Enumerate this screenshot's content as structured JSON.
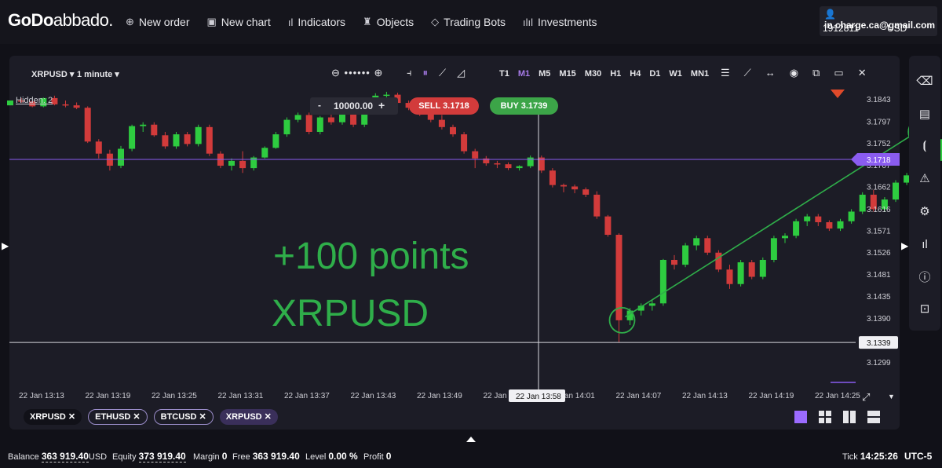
{
  "brand": {
    "name_bold": "GoDo",
    "name_thin": "abbado."
  },
  "nav": [
    {
      "icon": "⊕",
      "label": "New order"
    },
    {
      "icon": "▣",
      "label": "New chart"
    },
    {
      "icon": "ıl",
      "label": "Indicators"
    },
    {
      "icon": "♜",
      "label": "Objects"
    },
    {
      "icon": "◇",
      "label": "Trading Bots"
    },
    {
      "icon": "ılıl",
      "label": "Investments"
    }
  ],
  "account": {
    "email": "in.charge.ca@gmail.com",
    "id": "1912811",
    "currency": "USD"
  },
  "chart_header": {
    "symbol": "XRPUSD",
    "timeframe": "1 minute",
    "timeframes": [
      "T1",
      "M1",
      "M5",
      "M15",
      "M30",
      "H1",
      "H4",
      "D1",
      "W1",
      "MN1"
    ],
    "active_timeframe": "M1",
    "zoom_dots": "••••••"
  },
  "hidden_label": "Hidden: 2",
  "trade": {
    "minus": "-",
    "volume": "10000.00",
    "plus": "+",
    "sell_label": "SELL 3.1718",
    "buy_label": "BUY 3.1739"
  },
  "overlay": {
    "line1": "+100 points",
    "line2": "XRPUSD"
  },
  "chart_data": {
    "type": "candlestick",
    "symbol": "XRPUSD",
    "y_ticks": [
      "3.1843",
      "3.1797",
      "3.1752",
      "3.1707",
      "3.1662",
      "3.1616",
      "3.1571",
      "3.1526",
      "3.1481",
      "3.1435",
      "3.1390",
      "3.1345",
      "3.1299"
    ],
    "y_range": [
      3.1284,
      3.1866
    ],
    "x_ticks": [
      "22 Jan 13:13",
      "22 Jan 13:19",
      "22 Jan 13:25",
      "22 Jan 13:31",
      "22 Jan 13:37",
      "22 Jan 13:43",
      "22 Jan 13:49",
      "22 Jan 13:55",
      "22 Jan 14:01",
      "22 Jan 14:07",
      "22 Jan 14:13",
      "22 Jan 14:19",
      "22 Jan 14:25"
    ],
    "crosshair_time": "22 Jan 13:58",
    "current_price": "3.1718",
    "crosshair_price": "3.1339",
    "candles": [
      [
        3.183,
        3.184,
        3.183,
        3.184
      ],
      [
        3.184,
        3.1845,
        3.1835,
        3.1838
      ],
      [
        3.1838,
        3.184,
        3.1826,
        3.1828
      ],
      [
        3.1828,
        3.1846,
        3.1826,
        3.1845
      ],
      [
        3.1845,
        3.185,
        3.183,
        3.1832
      ],
      [
        3.1832,
        3.184,
        3.1826,
        3.183
      ],
      [
        3.183,
        3.1836,
        3.1822,
        3.1825
      ],
      [
        3.1825,
        3.1828,
        3.1752,
        3.1755
      ],
      [
        3.1755,
        3.176,
        3.172,
        3.173
      ],
      [
        3.173,
        3.1738,
        3.1695,
        3.1705
      ],
      [
        3.1705,
        3.1746,
        3.17,
        3.174
      ],
      [
        3.174,
        3.179,
        3.1735,
        3.1787
      ],
      [
        3.1787,
        3.1795,
        3.1775,
        3.179
      ],
      [
        3.179,
        3.1795,
        3.1765,
        3.1768
      ],
      [
        3.1768,
        3.1775,
        3.174,
        3.1745
      ],
      [
        3.1745,
        3.1775,
        3.174,
        3.177
      ],
      [
        3.177,
        3.1775,
        3.1745,
        3.175
      ],
      [
        3.175,
        3.179,
        3.1745,
        3.1785
      ],
      [
        3.1785,
        3.179,
        3.1725,
        3.173
      ],
      [
        3.173,
        3.1735,
        3.17,
        3.1705
      ],
      [
        3.1705,
        3.172,
        3.1695,
        3.1715
      ],
      [
        3.1715,
        3.1735,
        3.169,
        3.17
      ],
      [
        3.17,
        3.1725,
        3.1695,
        3.1722
      ],
      [
        3.1722,
        3.1745,
        3.172,
        3.1742
      ],
      [
        3.1742,
        3.1775,
        3.174,
        3.177
      ],
      [
        3.177,
        3.1805,
        3.1765,
        3.18
      ],
      [
        3.18,
        3.1815,
        3.1795,
        3.181
      ],
      [
        3.181,
        3.1815,
        3.177,
        3.1775
      ],
      [
        3.1775,
        3.1808,
        3.177,
        3.1805
      ],
      [
        3.1805,
        3.1815,
        3.179,
        3.1795
      ],
      [
        3.1795,
        3.182,
        3.179,
        3.1815
      ],
      [
        3.1815,
        3.182,
        3.1785,
        3.179
      ],
      [
        3.179,
        3.1822,
        3.1785,
        3.182
      ],
      [
        3.182,
        3.1855,
        3.1815,
        3.185
      ],
      [
        3.185,
        3.1858,
        3.184,
        3.1852
      ],
      [
        3.1852,
        3.1856,
        3.183,
        3.1835
      ],
      [
        3.1835,
        3.184,
        3.182,
        3.1825
      ],
      [
        3.1825,
        3.183,
        3.1808,
        3.1815
      ],
      [
        3.1815,
        3.182,
        3.1795,
        3.18
      ],
      [
        3.18,
        3.181,
        3.178,
        3.1785
      ],
      [
        3.1785,
        3.179,
        3.1765,
        3.177
      ],
      [
        3.177,
        3.1775,
        3.173,
        3.1735
      ],
      [
        3.1735,
        3.174,
        3.17,
        3.172
      ],
      [
        3.172,
        3.1725,
        3.1705,
        3.171
      ],
      [
        3.171,
        3.1715,
        3.17,
        3.1708
      ],
      [
        3.1708,
        3.1712,
        3.1696,
        3.17
      ],
      [
        3.17,
        3.1706,
        3.1695,
        3.1704
      ],
      [
        3.1704,
        3.1726,
        3.17,
        3.1722
      ],
      [
        3.1722,
        3.1726,
        3.169,
        3.1695
      ],
      [
        3.1695,
        3.17,
        3.166,
        3.1665
      ],
      [
        3.1665,
        3.1668,
        3.165,
        3.1662
      ],
      [
        3.1662,
        3.1666,
        3.1648,
        3.1656
      ],
      [
        3.1656,
        3.166,
        3.164,
        3.1645
      ],
      [
        3.1645,
        3.1652,
        3.1595,
        3.16
      ],
      [
        3.16,
        3.1603,
        3.1558,
        3.1562
      ],
      [
        3.1562,
        3.1565,
        3.134,
        3.1385
      ],
      [
        3.1385,
        3.141,
        3.1375,
        3.1405
      ],
      [
        3.1405,
        3.142,
        3.1395,
        3.1415
      ],
      [
        3.1415,
        3.1428,
        3.1405,
        3.142
      ],
      [
        3.142,
        3.1512,
        3.1415,
        3.151
      ],
      [
        3.151,
        3.152,
        3.149,
        3.15
      ],
      [
        3.15,
        3.1545,
        3.1495,
        3.154
      ],
      [
        3.154,
        3.156,
        3.153,
        3.1555
      ],
      [
        3.1555,
        3.156,
        3.152,
        3.1525
      ],
      [
        3.1525,
        3.153,
        3.1485,
        3.149
      ],
      [
        3.149,
        3.15,
        3.145,
        3.146
      ],
      [
        3.146,
        3.151,
        3.1455,
        3.1505
      ],
      [
        3.1505,
        3.151,
        3.147,
        3.1475
      ],
      [
        3.1475,
        3.1515,
        3.147,
        3.151
      ],
      [
        3.151,
        3.156,
        3.1505,
        3.1555
      ],
      [
        3.1555,
        3.1565,
        3.1545,
        3.156
      ],
      [
        3.156,
        3.1595,
        3.1555,
        3.159
      ],
      [
        3.159,
        3.1605,
        3.158,
        3.16
      ],
      [
        3.16,
        3.1605,
        3.158,
        3.1588
      ],
      [
        3.1588,
        3.1592,
        3.157,
        3.1575
      ],
      [
        3.1575,
        3.1595,
        3.157,
        3.159
      ],
      [
        3.159,
        3.1615,
        3.1585,
        3.161
      ],
      [
        3.161,
        3.165,
        3.1605,
        3.1645
      ],
      [
        3.1645,
        3.1655,
        3.161,
        3.1615
      ],
      [
        3.1615,
        3.164,
        3.161,
        3.1635
      ],
      [
        3.1635,
        3.1675,
        3.163,
        3.167
      ],
      [
        3.167,
        3.169,
        3.1665,
        3.1685
      ],
      [
        3.1685,
        3.17,
        3.168,
        3.1695
      ],
      [
        3.1695,
        3.172,
        3.169,
        3.1715
      ],
      [
        3.1715,
        3.1765,
        3.17,
        3.176
      ],
      [
        3.176,
        3.1775,
        3.1745,
        3.1765
      ],
      [
        3.1765,
        3.1768,
        3.1755,
        3.176
      ],
      [
        3.176,
        3.1765,
        3.1715,
        3.1725
      ],
      [
        3.1725,
        3.173,
        3.1716,
        3.1718
      ]
    ]
  },
  "trendline": {
    "from": [
      55,
      3.1392
    ],
    "to": [
      82,
      3.177
    ]
  },
  "circles": [
    {
      "x": 55,
      "y": 3.1385
    },
    {
      "x": 82,
      "y": 3.1775
    }
  ],
  "symbol_tabs": [
    "XRPUSD",
    "ETHUSD",
    "BTCUSD",
    "XRPUSD"
  ],
  "status": {
    "balance_label": "Balance",
    "balance": "363 919.40",
    "balance_cur": "USD",
    "equity_label": "Equity",
    "equity": "373 919.40",
    "margin_label": "Margin",
    "margin": "0",
    "free_label": "Free",
    "free": "363 919.40",
    "level_label": "Level",
    "level": "0.00 %",
    "profit_label": "Profit",
    "profit": "0",
    "tick_label": "Tick",
    "tick": "14:25:26",
    "tz": "UTC-5"
  },
  "colors": {
    "up": "#2ecc40",
    "down": "#d23b3b",
    "price_line": "#8a5cf0",
    "overlay_text": "#2fae4a",
    "accent": "#9b6bff"
  }
}
